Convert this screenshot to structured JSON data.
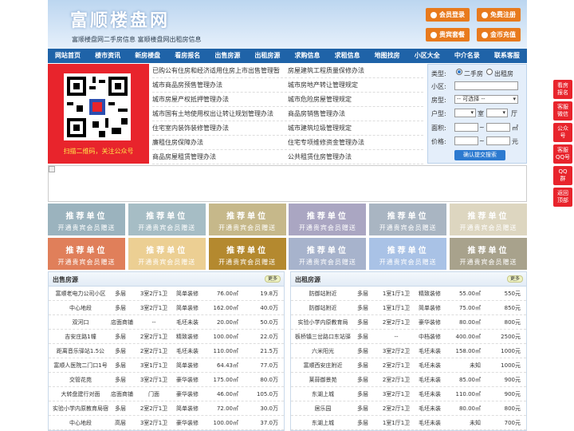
{
  "header": {
    "title": "富顺楼盘网",
    "subtitle": "富顺楼盘网二手房信息    富顺楼盘网出租房信息",
    "buttons": [
      "会员登录",
      "免费注册",
      "贵宾套餐",
      "金币充值"
    ]
  },
  "nav": [
    "网站首页",
    "楼市资讯",
    "新房楼盘",
    "看房报名",
    "出售房源",
    "出租房源",
    "求购信息",
    "求租信息",
    "地图找房",
    "小区大全",
    "中介名录",
    "联系客服"
  ],
  "qr": {
    "caption": "扫描二维码，关注公众号"
  },
  "links": [
    [
      "已购公有住房和经济适用住房上市出售管理暂",
      "房屋建筑工程质量保修办法"
    ],
    [
      "城市商品房预售管理办法",
      "城市房地产转让管理规定"
    ],
    [
      "城市房屋产权抵押管理办法",
      "城市危险房屋管理规定"
    ],
    [
      "城市国有土地使用权出让转让规划管理办法",
      "商品房销售管理办法"
    ],
    [
      "住宅室内装饰装修管理办法",
      "城市建筑垃圾管理规定"
    ],
    [
      "廉租住房保障办法",
      "住宅专项维修资金管理办法"
    ],
    [
      "商品房屋租赁管理办法",
      "公共租赁住房管理办法"
    ]
  ],
  "search": {
    "type_label": "类型:",
    "opt1": "二手房",
    "opt2": "出租房",
    "xiaoqu_label": "小区:",
    "fangxing_label": "房型:",
    "fangxing_value": "-- 可选择 --",
    "huxing_label": "户型:",
    "shi": "室",
    "ting": "厅",
    "area_label": "面积:",
    "price_label": "价格:",
    "tilde": "~",
    "sqm": "㎡",
    "yuan": "元",
    "submit": "确认提交搜索"
  },
  "promo": {
    "line1": "推荐单位",
    "line2": "开通贵宾会员赠送"
  },
  "promo_colors": [
    "#9bb3be",
    "#a6bdc5",
    "#c6b88a",
    "#aaa6c2",
    "#a9b5c2",
    "#ddd6c0",
    "#e07f5a",
    "#eccf93",
    "#b4892f",
    "#a7b3cc",
    "#a9c2e6",
    "#a8a28c"
  ],
  "sale": {
    "title": "出售房源",
    "more": "更多",
    "rows": [
      [
        "富顺老电力公司小区",
        "多层",
        "3室2厅1卫",
        "简单装修",
        "76.00㎡",
        "19.8万"
      ],
      [
        "中心地段",
        "多层",
        "3室2厅1卫",
        "简单装修",
        "162.00㎡",
        "40.0万"
      ],
      [
        "双河口",
        "店面商铺",
        "--",
        "毛坯未装",
        "20.00㎡",
        "50.0万"
      ],
      [
        "吉安庄路1幢",
        "多层",
        "2室2厅1卫",
        "精致装修",
        "100.00㎡",
        "22.0万"
      ],
      [
        "距离音乐驿站1.5公",
        "多层",
        "2室2厅1卫",
        "毛坯未装",
        "110.00㎡",
        "21.5万"
      ],
      [
        "富顺人医院二门口1号",
        "多层",
        "3室1厅1卫",
        "简单装修",
        "64.43㎡",
        "77.0万"
      ],
      [
        "交管花苑",
        "多层",
        "3室2厅1卫",
        "豪华装修",
        "175.00㎡",
        "80.0万"
      ],
      [
        "大转盘建行对面",
        "店面商铺",
        "门面",
        "豪华装修",
        "46.00㎡",
        "105.0万"
      ],
      [
        "实验小学内原教育局宿",
        "多层",
        "2室2厅1卫",
        "简单装修",
        "72.00㎡",
        "30.0万"
      ],
      [
        "中心地段",
        "高层",
        "3室2厅1卫",
        "豪华装修",
        "100.00㎡",
        "37.0万"
      ]
    ]
  },
  "rent": {
    "title": "出租房源",
    "more": "更多",
    "rows": [
      [
        "防御站附近",
        "多层",
        "1室1厅1卫",
        "精致装修",
        "55.00㎡",
        "550元"
      ],
      [
        "防御站附近",
        "多层",
        "1室1厅1卫",
        "简单装修",
        "75.00㎡",
        "850元"
      ],
      [
        "实验小学内原教育局",
        "多层",
        "2室2厅1卫",
        "豪华装修",
        "80.00㎡",
        "800元"
      ],
      [
        "板桥镇三岔路口东站驿",
        "多层",
        "--",
        "中档装修",
        "400.00㎡",
        "2500元"
      ],
      [
        "六米阳光",
        "多层",
        "3室2厅2卫",
        "毛坯未装",
        "158.00㎡",
        "1000元"
      ],
      [
        "富顺西安庄附近",
        "多层",
        "2室2厅1卫",
        "毛坯未装",
        "未知",
        "1000元"
      ],
      [
        "莱蒜御景苑",
        "多层",
        "2室2厅1卫",
        "毛坯未装",
        "85.00㎡",
        "900元"
      ],
      [
        "东湖上城",
        "多层",
        "3室2厅1卫",
        "毛坯未装",
        "110.00㎡",
        "900元"
      ],
      [
        "居乐园",
        "多层",
        "2室2厅1卫",
        "毛坯未装",
        "80.00㎡",
        "800元"
      ],
      [
        "东湖上城",
        "多层",
        "1室1厅1卫",
        "毛坯未装",
        "未知",
        "700元"
      ]
    ]
  },
  "side": [
    "看房\n报名",
    "客服\n微信",
    "公众\n号",
    "客服\nQQ号",
    "QQ\n群",
    "返回\n顶部"
  ]
}
